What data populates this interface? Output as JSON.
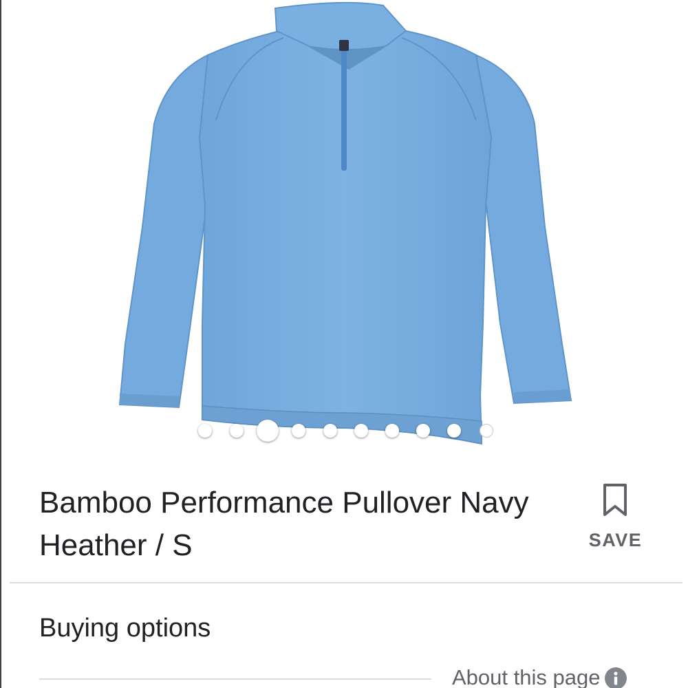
{
  "product": {
    "title": "Bamboo Performance Pullover Navy Heather / S",
    "image_icon": "pullover-photo",
    "image_color": "#78aee0"
  },
  "carousel": {
    "total_images": 10,
    "active_index": 2
  },
  "actions": {
    "save_label": "SAVE",
    "save_icon": "bookmark-icon"
  },
  "sections": {
    "buying_options": "Buying options"
  },
  "footer": {
    "about_label": "About this page",
    "about_icon": "info-icon"
  }
}
